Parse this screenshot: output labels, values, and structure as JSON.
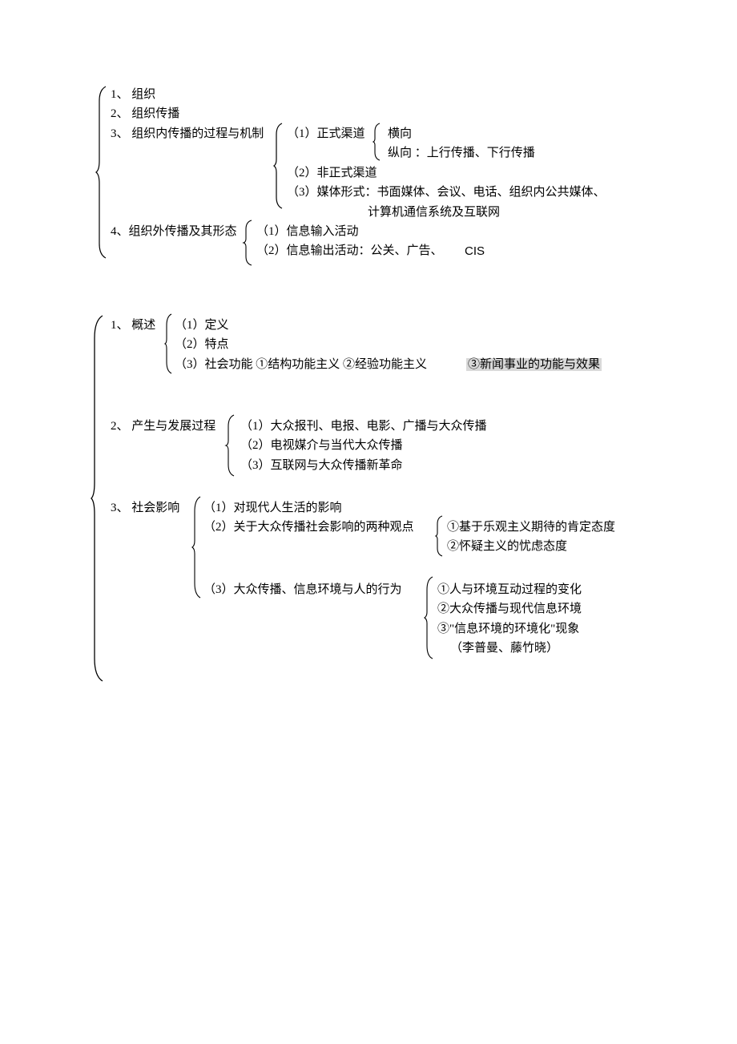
{
  "sectionA": {
    "item1": "1、 组织",
    "item2": "2、 组织传播",
    "item3": "3、 组织内传播的过程与机制",
    "item3_1": "（1）正式渠道",
    "item3_1a": "横向",
    "item3_1b": "纵向 ：上行传播、下行传播",
    "item3_2": "（2）非正式渠道",
    "item3_3": "（3）媒体形式：书面媒体、会议、电话、组织内公共媒体、",
    "item3_3b": "计算机通信系统及互联网",
    "item4": "4、组织外传播及其形态",
    "item4_1": "（1）信息输入活动",
    "item4_2": "（2）信息输出活动：公关、广告、",
    "item4_2_cis": "CIS"
  },
  "sectionB": {
    "item1": "1、 概述",
    "item1_1": "（1）定义",
    "item1_2": "（2）特点",
    "item1_3a": "（3）社会功能   ①结构功能主义   ②经验功能主义",
    "item1_3b": "③新闻事业的功能与效果",
    "item2": "2、 产生与发展过程",
    "item2_1": "（1）大众报刊、电报、电影、广播与大众传播",
    "item2_2": "（2）电视媒介与当代大众传播",
    "item2_3": "（3）互联网与大众传播新革命",
    "item3": "3、 社会影响",
    "item3_1": "（1）对现代人生活的影响",
    "item3_2": "（2）关于大众传播社会影响的两种观点",
    "item3_2a": "①基于乐观主义期待的肯定态度",
    "item3_2b": "②怀疑主义的忧虑态度",
    "item3_3": "（3）大众传播、信息环境与人的行为",
    "item3_3a": "①人与环境互动过程的变化",
    "item3_3b": "②大众传播与现代信息环境",
    "item3_3c": "③\"信息环境的环境化\"现象",
    "item3_3d": "（李普曼、藤竹晓）"
  }
}
